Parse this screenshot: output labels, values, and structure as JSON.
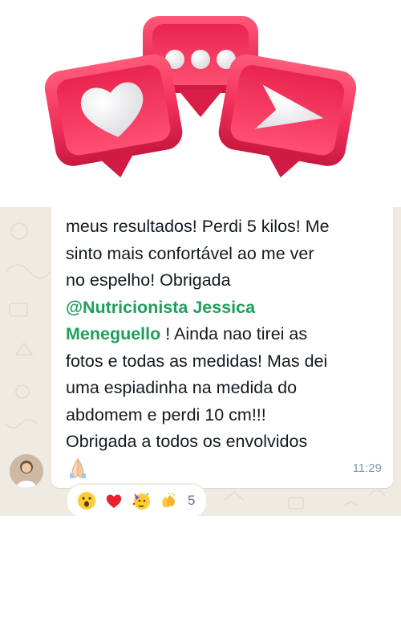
{
  "message": {
    "lines": [
      "meus resultados! Perdi 5 kilos! Me",
      "sinto mais confortável ao me ver",
      "no espelho! Obrigada"
    ],
    "mention_line1": "@Nutricionista Jessica",
    "mention_line2": "Meneguello",
    "after_mention": " ! Ainda nao tirei as",
    "lines_after": [
      "fotos e todas as medidas! Mas dei",
      "uma espiadinha na medida do",
      "abdomem e perdi 10 cm!!!",
      "Obrigada  a todos os envolvidos"
    ],
    "time": "11:29"
  },
  "reactions": {
    "icons": [
      "astonished-face-icon",
      "red-heart-icon",
      "partying-face-icon",
      "clapping-hands-icon"
    ],
    "count": "5"
  },
  "colors": {
    "chat_background": "#efeae2",
    "mention": "#1f9f5b",
    "icon_red": "#f0305a",
    "time": "#8696a0"
  }
}
